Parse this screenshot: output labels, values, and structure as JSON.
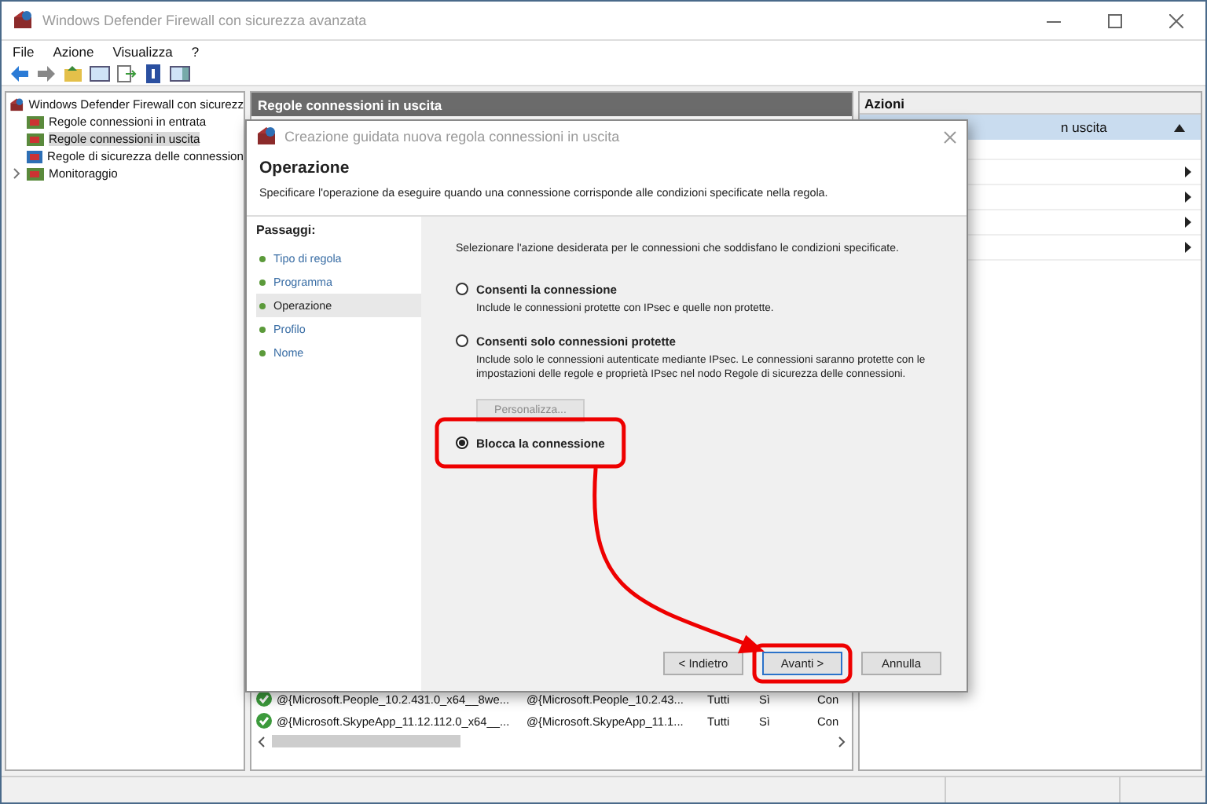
{
  "window": {
    "title": "Windows Defender Firewall con sicurezza avanzata"
  },
  "menu": [
    "File",
    "Azione",
    "Visualizza",
    "?"
  ],
  "tree": {
    "label": "Windows Defender Firewall con sicurezz",
    "children": [
      {
        "label": "Regole connessioni in entrata",
        "selected": false,
        "collapsed": false
      },
      {
        "label": "Regole connessioni in uscita",
        "selected": true,
        "collapsed": false
      },
      {
        "label": "Regole di sicurezza delle connession",
        "selected": false,
        "collapsed": false
      },
      {
        "label": "Monitoraggio",
        "selected": false,
        "collapsed": true
      }
    ]
  },
  "center": {
    "header": "Regole connessioni in uscita",
    "rows": [
      {
        "enabled": true,
        "cells": [
          "@{Microsoft.People_10.2.431.0_x64__8we...",
          "@{Microsoft.People_10.2.43...",
          "Tutti",
          "Sì",
          "Con"
        ]
      },
      {
        "enabled": true,
        "cells": [
          "@{Microsoft.SkypeApp_11.12.112.0_x64__...",
          "@{Microsoft.SkypeApp_11.1...",
          "Tutti",
          "Sì",
          "Con"
        ]
      }
    ]
  },
  "actions": {
    "title": "Azioni",
    "items": [
      {
        "kind": "section",
        "label": "n uscita"
      },
      {
        "kind": "blank"
      },
      {
        "kind": "submenu"
      },
      {
        "kind": "submenu"
      },
      {
        "kind": "submenu"
      },
      {
        "kind": "submenu"
      }
    ]
  },
  "dialog": {
    "title": "Creazione guidata nuova regola connessioni in uscita",
    "heading": "Operazione",
    "description": "Specificare l'operazione da eseguire quando una connessione corrisponde alle condizioni specificate nella regola.",
    "steps_title": "Passaggi:",
    "steps": [
      {
        "label": "Tipo di regola",
        "selected": false
      },
      {
        "label": "Programma",
        "selected": false
      },
      {
        "label": "Operazione",
        "selected": true
      },
      {
        "label": "Profilo",
        "selected": false
      },
      {
        "label": "Nome",
        "selected": false
      }
    ],
    "prompt": "Selezionare l'azione desiderata per le connessioni che soddisfano le condizioni specificate.",
    "options": [
      {
        "label": "Consenti la connessione",
        "description": "Include le connessioni protette con IPsec e quelle non protette.",
        "selected": false
      },
      {
        "label": "Consenti solo connessioni protette",
        "description": "Include solo le connessioni autenticate mediante IPsec. Le connessioni saranno protette con le impostazioni delle regole e proprietà IPsec nel nodo Regole di sicurezza delle connessioni.",
        "selected": false,
        "customize": {
          "label": "Personalizza...",
          "disabled": true
        }
      },
      {
        "label": "Blocca la connessione",
        "selected": true
      }
    ],
    "buttons": [
      {
        "label": "< Indietro",
        "default": false
      },
      {
        "label": "Avanti >",
        "default": true
      },
      {
        "label": "Annulla",
        "default": false
      }
    ]
  },
  "annotations": [
    {
      "kind": "option-frame"
    },
    {
      "kind": "button-frame"
    },
    {
      "kind": "arrow"
    }
  ]
}
